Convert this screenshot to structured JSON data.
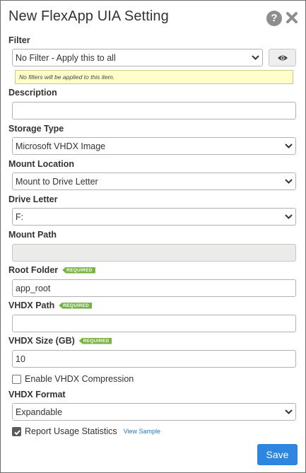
{
  "dialog": {
    "title": "New FlexApp UIA Setting"
  },
  "filter": {
    "label": "Filter",
    "value": "No Filter - Apply this to all",
    "note": "No filters will be applied to this item."
  },
  "description": {
    "label": "Description",
    "value": ""
  },
  "storage_type": {
    "label": "Storage Type",
    "value": "Microsoft VHDX Image"
  },
  "mount_location": {
    "label": "Mount Location",
    "value": "Mount to Drive Letter"
  },
  "drive_letter": {
    "label": "Drive Letter",
    "value": "F:"
  },
  "mount_path": {
    "label": "Mount Path",
    "value": ""
  },
  "root_folder": {
    "label": "Root Folder",
    "badge": "REQUIRED",
    "value": "app_root"
  },
  "vhdx_path": {
    "label": "VHDX Path",
    "badge": "REQUIRED",
    "value": ""
  },
  "vhdx_size": {
    "label": "VHDX Size (GB)",
    "badge": "REQUIRED",
    "value": "10"
  },
  "compression": {
    "label": "Enable VHDX Compression",
    "checked": false
  },
  "vhdx_format": {
    "label": "VHDX Format",
    "value": "Expandable"
  },
  "usage_stats": {
    "label": "Report Usage Statistics",
    "checked": true,
    "link": "View Sample"
  },
  "actions": {
    "save_label": "Save"
  },
  "icons": {
    "help": "help-icon",
    "close": "close-icon",
    "eye": "eye-icon",
    "chevron": "chevron-down-icon",
    "check": "check-icon"
  },
  "colors": {
    "primary": "#2e86de",
    "required_badge": "#76b341",
    "note_background": "#ffffc8",
    "link": "#2a76c6"
  }
}
